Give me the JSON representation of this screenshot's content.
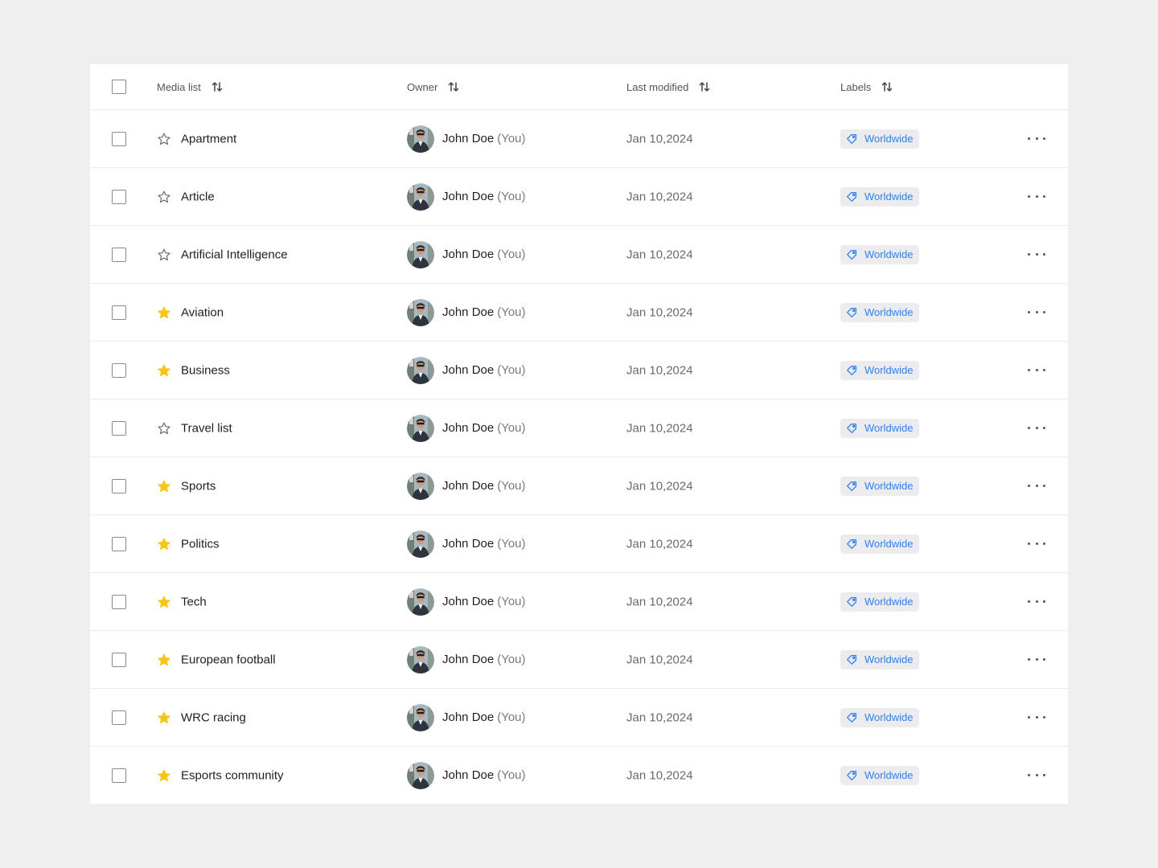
{
  "colors": {
    "star_active": "#F5C518",
    "star_inactive": "#6b6b6b",
    "label_text": "#2F80ED",
    "label_bg": "#ECECEE"
  },
  "header": {
    "media_list": "Media list",
    "owner": "Owner",
    "last_modified": "Last modified",
    "labels": "Labels"
  },
  "rows": [
    {
      "name": "Apartment",
      "starred": false,
      "owner": "John Doe",
      "owner_suffix": "(You)",
      "modified": "Jan 10,2024",
      "label": "Worldwide"
    },
    {
      "name": "Article",
      "starred": false,
      "owner": "John Doe",
      "owner_suffix": "(You)",
      "modified": "Jan 10,2024",
      "label": "Worldwide"
    },
    {
      "name": "Artificial Intelligence",
      "starred": false,
      "owner": "John Doe",
      "owner_suffix": "(You)",
      "modified": "Jan 10,2024",
      "label": "Worldwide"
    },
    {
      "name": "Aviation",
      "starred": true,
      "owner": "John Doe",
      "owner_suffix": "(You)",
      "modified": "Jan 10,2024",
      "label": "Worldwide"
    },
    {
      "name": "Business",
      "starred": true,
      "owner": "John Doe",
      "owner_suffix": "(You)",
      "modified": "Jan 10,2024",
      "label": "Worldwide"
    },
    {
      "name": "Travel list",
      "starred": false,
      "owner": "John Doe",
      "owner_suffix": "(You)",
      "modified": "Jan 10,2024",
      "label": "Worldwide"
    },
    {
      "name": "Sports",
      "starred": true,
      "owner": "John Doe",
      "owner_suffix": "(You)",
      "modified": "Jan 10,2024",
      "label": "Worldwide"
    },
    {
      "name": "Politics",
      "starred": true,
      "owner": "John Doe",
      "owner_suffix": "(You)",
      "modified": "Jan 10,2024",
      "label": "Worldwide"
    },
    {
      "name": "Tech",
      "starred": true,
      "owner": "John Doe",
      "owner_suffix": "(You)",
      "modified": "Jan 10,2024",
      "label": "Worldwide"
    },
    {
      "name": "European football",
      "starred": true,
      "owner": "John Doe",
      "owner_suffix": "(You)",
      "modified": "Jan 10,2024",
      "label": "Worldwide"
    },
    {
      "name": "WRC racing",
      "starred": true,
      "owner": "John Doe",
      "owner_suffix": "(You)",
      "modified": "Jan 10,2024",
      "label": "Worldwide"
    },
    {
      "name": "Esports community",
      "starred": true,
      "owner": "John Doe",
      "owner_suffix": "(You)",
      "modified": "Jan 10,2024",
      "label": "Worldwide"
    }
  ],
  "icons": {
    "sort": "sort-icon",
    "star": "star-icon",
    "tag": "tag-icon",
    "more": "more-horizontal-icon",
    "avatar": "avatar"
  }
}
